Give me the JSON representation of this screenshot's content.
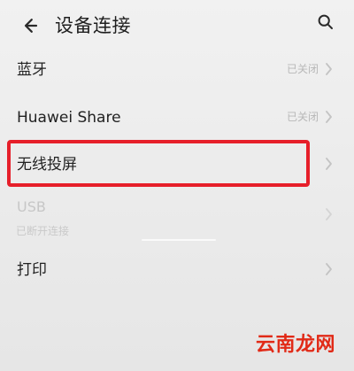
{
  "header": {
    "title": "设备连接"
  },
  "list": {
    "items": [
      {
        "label": "蓝牙",
        "status": "已关闭"
      },
      {
        "label": "Huawei Share",
        "status": "已关闭"
      },
      {
        "label": "无线投屏"
      },
      {
        "label": "USB",
        "subtext": "已断开连接"
      },
      {
        "label": "打印"
      }
    ]
  },
  "watermark": {
    "text": "云南龙网"
  },
  "colors": {
    "background": "#ececec",
    "text_primary": "#1f1f1f",
    "text_secondary": "#b8b8b8",
    "highlight": "#e61f2a",
    "watermark": "#e12a17"
  },
  "icons": {
    "back": "back-arrow-icon",
    "search": "search-icon",
    "chevron": "chevron-right-icon"
  }
}
